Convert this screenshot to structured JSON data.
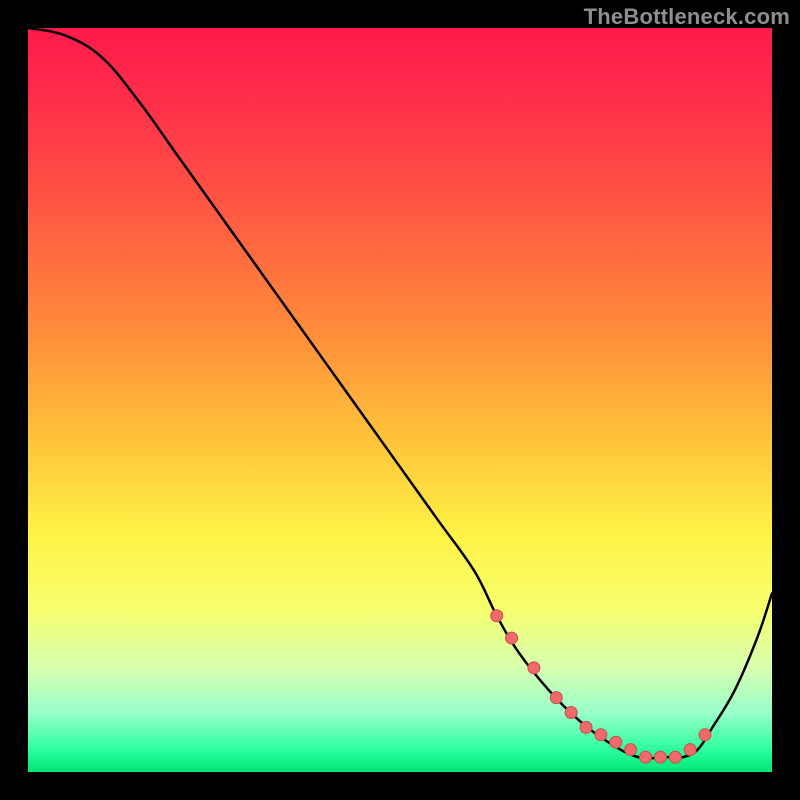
{
  "watermark": "TheBottleneck.com",
  "colors": {
    "gradient_stops": [
      {
        "offset": 0.0,
        "color": "#ff1a4b"
      },
      {
        "offset": 0.1,
        "color": "#ff2f4a"
      },
      {
        "offset": 0.25,
        "color": "#ff5a42"
      },
      {
        "offset": 0.4,
        "color": "#ff8a3a"
      },
      {
        "offset": 0.55,
        "color": "#ffc23a"
      },
      {
        "offset": 0.68,
        "color": "#fff246"
      },
      {
        "offset": 0.78,
        "color": "#f8ff6d"
      },
      {
        "offset": 0.86,
        "color": "#d6ffb0"
      },
      {
        "offset": 0.92,
        "color": "#9affc9"
      },
      {
        "offset": 0.97,
        "color": "#2cff9d"
      },
      {
        "offset": 1.0,
        "color": "#00e676"
      }
    ],
    "curve": "#000000",
    "marker_fill": "#f06a6a",
    "marker_stroke": "#c94d4d",
    "background": "#000000"
  },
  "chart_data": {
    "type": "line",
    "title": "",
    "xlabel": "",
    "ylabel": "",
    "xlim": [
      0,
      100
    ],
    "ylim": [
      0,
      100
    ],
    "series": [
      {
        "name": "bottleneck-curve",
        "x": [
          0,
          5,
          10,
          15,
          20,
          25,
          30,
          35,
          40,
          45,
          50,
          55,
          60,
          63,
          66,
          70,
          74,
          78,
          82,
          86,
          88,
          90,
          92,
          95,
          98,
          100
        ],
        "y": [
          100,
          99,
          96,
          90,
          83,
          76,
          69,
          62,
          55,
          48,
          41,
          34,
          27,
          21,
          16,
          11,
          7,
          4,
          2,
          2,
          2,
          3,
          6,
          11,
          18,
          24
        ]
      }
    ],
    "markers": {
      "name": "highlight-points",
      "x": [
        63,
        65,
        68,
        71,
        73,
        75,
        77,
        79,
        81,
        83,
        85,
        87,
        89,
        91
      ],
      "y": [
        21,
        18,
        14,
        10,
        8,
        6,
        5,
        4,
        3,
        2,
        2,
        2,
        3,
        5
      ]
    }
  }
}
